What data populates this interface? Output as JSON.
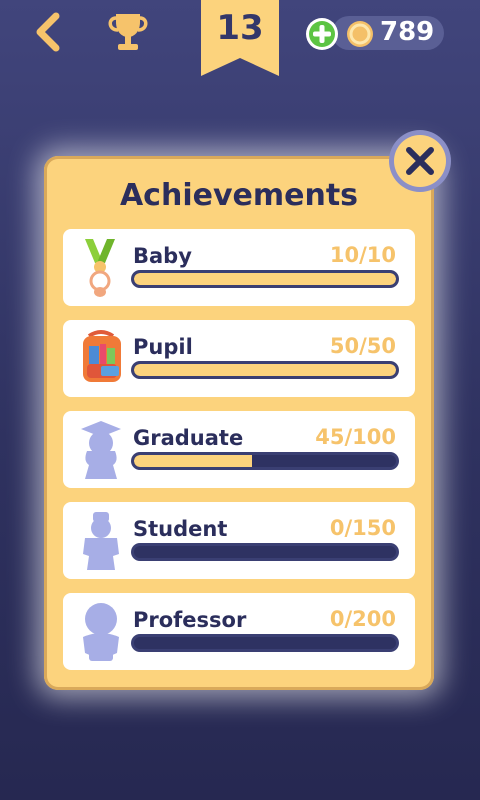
{
  "header": {
    "level": "13",
    "coins": "789"
  },
  "panel": {
    "title": "Achievements",
    "items": [
      {
        "name": "Baby",
        "progress": "10/10",
        "fraction": 1.0,
        "unlocked": true
      },
      {
        "name": "Pupil",
        "progress": "50/50",
        "fraction": 1.0,
        "unlocked": true
      },
      {
        "name": "Graduate",
        "progress": "45/100",
        "fraction": 0.45,
        "unlocked": false
      },
      {
        "name": "Student",
        "progress": "0/150",
        "fraction": 0.0,
        "unlocked": false
      },
      {
        "name": "Professor",
        "progress": "0/200",
        "fraction": 0.0,
        "unlocked": false
      }
    ]
  },
  "colors": {
    "background": "#363a6c",
    "accent": "#fcd37d",
    "text_dark": "#2b2e5c",
    "bar_dark": "#2e3262",
    "silhouette": "#a7aee6"
  },
  "icons": {
    "back": "chevron-left-icon",
    "trophy": "trophy-icon",
    "add": "plus-circle-icon",
    "coin": "coin-icon",
    "close": "close-icon"
  }
}
